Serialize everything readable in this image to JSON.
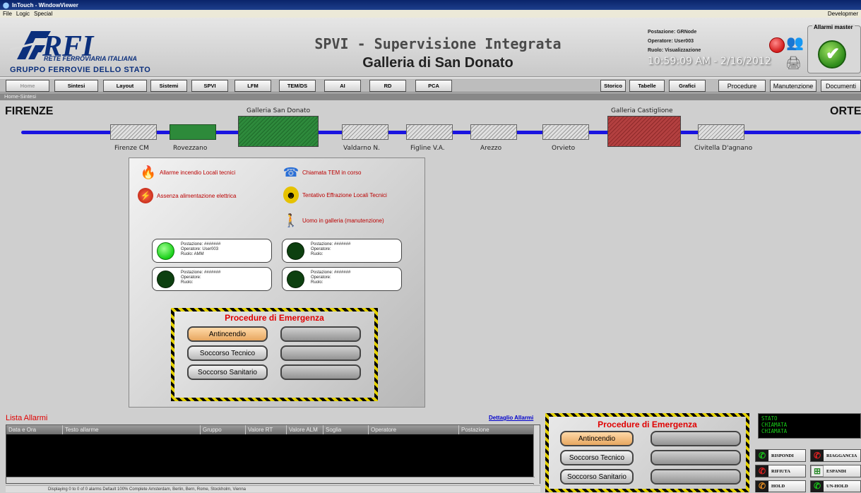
{
  "window": {
    "title": "InTouch - WindowViewer",
    "menu": [
      "File",
      "Logic",
      "Special"
    ],
    "mode": "Developmer"
  },
  "header": {
    "logo_rfi": "RFI",
    "logo_rete": "RETE FERROVIARIA ITALIANA",
    "logo_gruppo": "GRUPPO FERROVIE DELLO STATO",
    "title": "SPVI - Supervisione Integrata",
    "subtitle": "Galleria di San Donato",
    "postazione": "Postazione: GRNode",
    "operatore": "Operatore: User003",
    "ruolo": "Ruolo: Visualizzazione",
    "clock": "10:59:09 AM - 2/16/2012",
    "alarm_master_label": "Allarmi master"
  },
  "nav": {
    "home": "Home",
    "sintesi": "Sintesi",
    "layout": "Layout",
    "sistemi": "Sistemi",
    "spvi": "SPVI",
    "lfm": "LFM",
    "temds": "TEM/DS",
    "ai": "AI",
    "rd": "RD",
    "pca": "PCA",
    "storico": "Storico",
    "tabelle": "Tabelle",
    "grafici": "Grafici",
    "procedure": "Procedure",
    "manutenzione": "Manutenzione",
    "documenti": "Documenti"
  },
  "breadcrumb": "Home-Sintesi",
  "line": {
    "start": "FIRENZE",
    "end": "ORTE",
    "tunnels": [
      "Galleria San Donato",
      "Galleria Castiglione"
    ],
    "stations": [
      "Firenze CM",
      "Rovezzano",
      "Valdarno N.",
      "Figline V.A.",
      "Arezzo",
      "Orvieto",
      "Civitella D'agnano"
    ]
  },
  "legend": {
    "fire": "Allarme incendio Locali tecnici",
    "power": "Assenza alimentazione elettrica",
    "tem": "Chiamata TEM in corso",
    "intrusion": "Tentativo Effrazione Locali Tecnici",
    "man": "Uomo in galleria (manutenzione)"
  },
  "workstations": [
    {
      "postazione": "Postazione: #######",
      "operatore": "Operatore: User003",
      "ruolo": "Ruolo: AMM",
      "active": true
    },
    {
      "postazione": "Postazione: #######",
      "operatore": "Operatore:",
      "ruolo": "Ruolo:",
      "active": false
    },
    {
      "postazione": "Postazione: #######",
      "operatore": "Operatore:",
      "ruolo": "Ruolo:",
      "active": false
    },
    {
      "postazione": "Postazione: #######",
      "operatore": "Operatore:",
      "ruolo": "Ruolo:",
      "active": false
    }
  ],
  "emergency": {
    "title": "Procedure di Emergenza",
    "antincendio": "Antincendio",
    "tecnico": "Soccorso Tecnico",
    "sanitario": "Soccorso Sanitario"
  },
  "alarms": {
    "title": "Lista Allarmi",
    "details_link": "Dettaglio Allarmi",
    "columns": [
      "Data e Ora",
      "Testo allarme",
      "Gruppo",
      "Valore RT",
      "Valore ALM",
      "Soglia",
      "Operatore",
      "Postazione"
    ],
    "status": "Displaying 0 to 0 of 0 alarms   Default   100% Complete   Amsterdam, Berlin, Bern, Rome, Stockholm, Vienna"
  },
  "phone": {
    "stato_lines": [
      "STATO",
      "CHIAMATA",
      "CHIAMATA"
    ],
    "rispondi": "RISPONDI",
    "riaggancia": "RIAGGANCIA",
    "rifiuta": "RIFIUTA",
    "espandi": "ESPANDI",
    "hold": "HOLD",
    "unhold": "UN-HOLD"
  },
  "colors": {
    "line": "#1a14e0",
    "active_tunnel": "#2e8a3c",
    "alarm_tunnel": "#b34040",
    "emergency_title": "#e00000"
  }
}
